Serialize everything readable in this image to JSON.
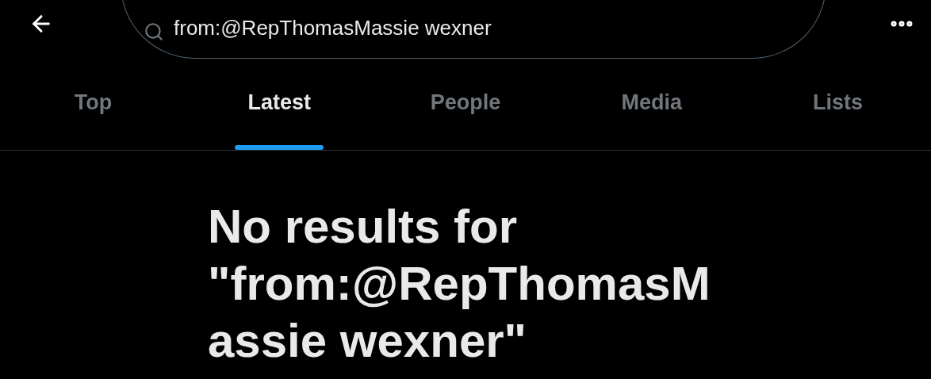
{
  "search": {
    "value": "from:@RepThomasMassie wexner"
  },
  "tabs": [
    {
      "label": "Top",
      "selected": false
    },
    {
      "label": "Latest",
      "selected": true
    },
    {
      "label": "People",
      "selected": false
    },
    {
      "label": "Media",
      "selected": false
    },
    {
      "label": "Lists",
      "selected": false
    }
  ],
  "empty_state": {
    "title": "No results for \"from:@RepThomasMassie wexner\""
  }
}
